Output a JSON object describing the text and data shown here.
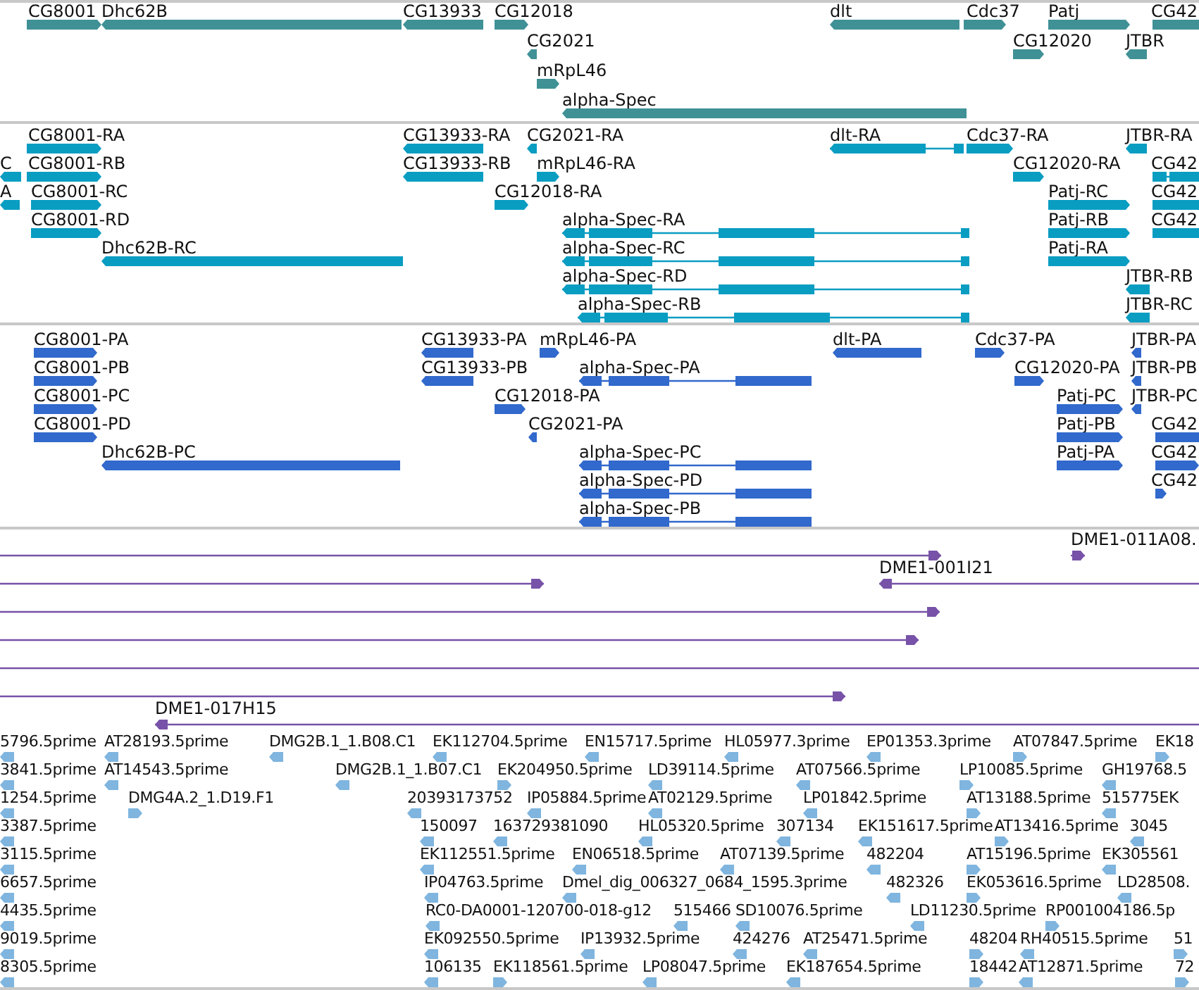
{
  "tracks": [
    {
      "kind": "gene",
      "features": [
        {
          "label": "CG8001",
          "reverse": false
        },
        {
          "label": "Dhc62B",
          "reverse": true
        },
        {
          "label": "CG13933",
          "reverse": true
        },
        {
          "label": "CG12018",
          "reverse": false
        },
        {
          "label": "dlt",
          "reverse": true
        },
        {
          "label": "Cdc37",
          "reverse": false
        },
        {
          "label": "Patj",
          "reverse": false
        },
        {
          "label": "CG42",
          "reverse": false
        },
        {
          "label": "CG2021",
          "reverse": true
        },
        {
          "label": "CG12020",
          "reverse": false
        },
        {
          "label": "JTBR",
          "reverse": true
        },
        {
          "label": "mRpL46",
          "reverse": false
        },
        {
          "label": "alpha-Spec",
          "reverse": true
        }
      ]
    },
    {
      "kind": "mrna",
      "features": [
        {
          "label": "CG8001-RA",
          "reverse": false
        },
        {
          "label": "CG13933-RA",
          "reverse": true
        },
        {
          "label": "CG2021-RA",
          "reverse": true
        },
        {
          "label": "dlt-RA",
          "reverse": true
        },
        {
          "label": "Cdc37-RA",
          "reverse": false
        },
        {
          "label": "JTBR-RA",
          "reverse": true
        },
        {
          "label": "C",
          "reverse": true
        },
        {
          "label": "CG8001-RB",
          "reverse": false
        },
        {
          "label": "CG13933-RB",
          "reverse": true
        },
        {
          "label": "mRpL46-RA",
          "reverse": false
        },
        {
          "label": "CG12020-RA",
          "reverse": false
        },
        {
          "label": "CG42",
          "reverse": false
        },
        {
          "label": "A",
          "reverse": true
        },
        {
          "label": "CG8001-RC",
          "reverse": false
        },
        {
          "label": "CG12018-RA",
          "reverse": false
        },
        {
          "label": "Patj-RC",
          "reverse": false
        },
        {
          "label": "CG42",
          "reverse": false
        },
        {
          "label": "CG8001-RD",
          "reverse": false
        },
        {
          "label": "alpha-Spec-RA",
          "reverse": true
        },
        {
          "label": "Patj-RB",
          "reverse": false
        },
        {
          "label": "CG42",
          "reverse": false
        },
        {
          "label": "Dhc62B-RC",
          "reverse": true
        },
        {
          "label": "alpha-Spec-RC",
          "reverse": true
        },
        {
          "label": "Patj-RA",
          "reverse": false
        },
        {
          "label": "alpha-Spec-RD",
          "reverse": true
        },
        {
          "label": "JTBR-RB",
          "reverse": true
        },
        {
          "label": "alpha-Spec-RB",
          "reverse": true
        },
        {
          "label": "JTBR-RC",
          "reverse": true
        }
      ]
    },
    {
      "kind": "protein",
      "features": [
        {
          "label": "CG8001-PA",
          "reverse": false
        },
        {
          "label": "CG13933-PA",
          "reverse": true
        },
        {
          "label": "mRpL46-PA",
          "reverse": false
        },
        {
          "label": "dlt-PA",
          "reverse": true
        },
        {
          "label": "Cdc37-PA",
          "reverse": false
        },
        {
          "label": "JTBR-PA",
          "reverse": true
        },
        {
          "label": "CG8001-PB",
          "reverse": false
        },
        {
          "label": "CG13933-PB",
          "reverse": true
        },
        {
          "label": "alpha-Spec-PA",
          "reverse": true
        },
        {
          "label": "CG12020-PA",
          "reverse": false
        },
        {
          "label": "JTBR-PB",
          "reverse": true
        },
        {
          "label": "CG8001-PC",
          "reverse": false
        },
        {
          "label": "CG12018-PA",
          "reverse": false
        },
        {
          "label": "Patj-PC",
          "reverse": false
        },
        {
          "label": "JTBR-PC",
          "reverse": true
        },
        {
          "label": "CG8001-PD",
          "reverse": false
        },
        {
          "label": "CG2021-PA",
          "reverse": true
        },
        {
          "label": "Patj-PB",
          "reverse": false
        },
        {
          "label": "CG42",
          "reverse": false
        },
        {
          "label": "Dhc62B-PC",
          "reverse": true
        },
        {
          "label": "alpha-Spec-PC",
          "reverse": true
        },
        {
          "label": "Patj-PA",
          "reverse": false
        },
        {
          "label": "CG42",
          "reverse": false
        },
        {
          "label": "alpha-Spec-PD",
          "reverse": true
        },
        {
          "label": "CG42",
          "reverse": false
        },
        {
          "label": "alpha-Spec-PB",
          "reverse": true
        }
      ]
    },
    {
      "kind": "clone",
      "features": [
        {
          "reverse": false
        },
        {
          "label": "DME1-011A08.",
          "reverse": false
        },
        {
          "reverse": false
        },
        {
          "label": "DME1-001I21",
          "reverse": true
        },
        {
          "reverse": false
        },
        {
          "reverse": false
        },
        {
          "reverse": false
        },
        {
          "reverse": false
        },
        {
          "label": "DME1-017H15",
          "reverse": true
        }
      ]
    },
    {
      "kind": "est",
      "features": [
        {
          "label": "5796.5prime",
          "reverse": true
        },
        {
          "label": "AT28193.5prime",
          "reverse": true
        },
        {
          "label": "DMG2B.1_1.B08.C1",
          "reverse": true
        },
        {
          "label": "EK112704.5prime",
          "reverse": true
        },
        {
          "label": "EN15717.5prime",
          "reverse": true
        },
        {
          "label": "HL05977.3prime",
          "reverse": true
        },
        {
          "label": "EP01353.3prime",
          "reverse": true
        },
        {
          "label": "AT07847.5prime",
          "reverse": false
        },
        {
          "label": "EK18",
          "reverse": false
        },
        {
          "label": "3841.5prime",
          "reverse": true
        },
        {
          "label": "AT14543.5prime",
          "reverse": true
        },
        {
          "label": "DMG2B.1_1.B07.C1",
          "reverse": true
        },
        {
          "label": "EK204950.5prime",
          "reverse": false
        },
        {
          "label": "LD39114.5prime",
          "reverse": true
        },
        {
          "label": "AT07566.5prime",
          "reverse": true
        },
        {
          "label": "LP10085.5prime",
          "reverse": false
        },
        {
          "label": "GH19768.5",
          "reverse": true
        },
        {
          "label": "1254.5prime",
          "reverse": true
        },
        {
          "label": "DMG4A.2_1.D19.F1",
          "reverse": false
        },
        {
          "label": "20393173752",
          "reverse": true
        },
        {
          "label": "IP05884.5prime",
          "reverse": true
        },
        {
          "label": "AT02129.5prime",
          "reverse": true
        },
        {
          "label": "LP01842.5prime",
          "reverse": true
        },
        {
          "label": "AT13188.5prime",
          "reverse": false
        },
        {
          "label": "515775EK",
          "reverse": true
        },
        {
          "label": "3387.5prime",
          "reverse": true
        },
        {
          "label": "150097",
          "reverse": true
        },
        {
          "label": "163729381090",
          "reverse": true
        },
        {
          "label": "HL05320.5prime",
          "reverse": true
        },
        {
          "label": "307134",
          "reverse": true
        },
        {
          "label": "EK151617.5prime",
          "reverse": true
        },
        {
          "label": "AT13416.5prime",
          "reverse": false
        },
        {
          "label": "3045",
          "reverse": true
        },
        {
          "label": "3115.5prime",
          "reverse": true
        },
        {
          "label": "EK112551.5prime",
          "reverse": true
        },
        {
          "label": "EN06518.5prime",
          "reverse": true
        },
        {
          "label": "AT07139.5prime",
          "reverse": true
        },
        {
          "label": "482204",
          "reverse": true
        },
        {
          "label": "AT15196.5prime",
          "reverse": false
        },
        {
          "label": "EK305561",
          "reverse": true
        },
        {
          "label": "6657.5prime",
          "reverse": true
        },
        {
          "label": "IP04763.5prime",
          "reverse": true
        },
        {
          "label": "Dmel_dig_006327_0684_1595.3prime",
          "reverse": true
        },
        {
          "label": "482326",
          "reverse": true
        },
        {
          "label": "EK053616.5prime",
          "reverse": false
        },
        {
          "label": "LD28508.",
          "reverse": true
        },
        {
          "label": "4435.5prime",
          "reverse": true
        },
        {
          "label": "RC0-DA0001-120700-018-g12",
          "reverse": true
        },
        {
          "label": "515466",
          "reverse": true
        },
        {
          "label": "SD10076.5prime",
          "reverse": true
        },
        {
          "label": "LD11230.5prime",
          "reverse": true
        },
        {
          "label": "RP001004186.5p",
          "reverse": false
        },
        {
          "label": "9019.5prime",
          "reverse": true
        },
        {
          "label": "EK092550.5prime",
          "reverse": true
        },
        {
          "label": "IP13932.5prime",
          "reverse": true
        },
        {
          "label": "424276",
          "reverse": true
        },
        {
          "label": "AT25471.5prime",
          "reverse": true
        },
        {
          "label": "48204",
          "reverse": false
        },
        {
          "label": "RH40515.5prime",
          "reverse": true
        },
        {
          "label": "51",
          "reverse": false
        },
        {
          "label": "8305.5prime",
          "reverse": true
        },
        {
          "label": "106135",
          "reverse": true
        },
        {
          "label": "EK118561.5prime",
          "reverse": false
        },
        {
          "label": "LP08047.5prime",
          "reverse": true
        },
        {
          "label": "EK187654.5prime",
          "reverse": true
        },
        {
          "label": "18442",
          "reverse": false
        },
        {
          "label": "AT12871.5prime",
          "reverse": true
        },
        {
          "label": "72",
          "reverse": false
        }
      ]
    }
  ]
}
